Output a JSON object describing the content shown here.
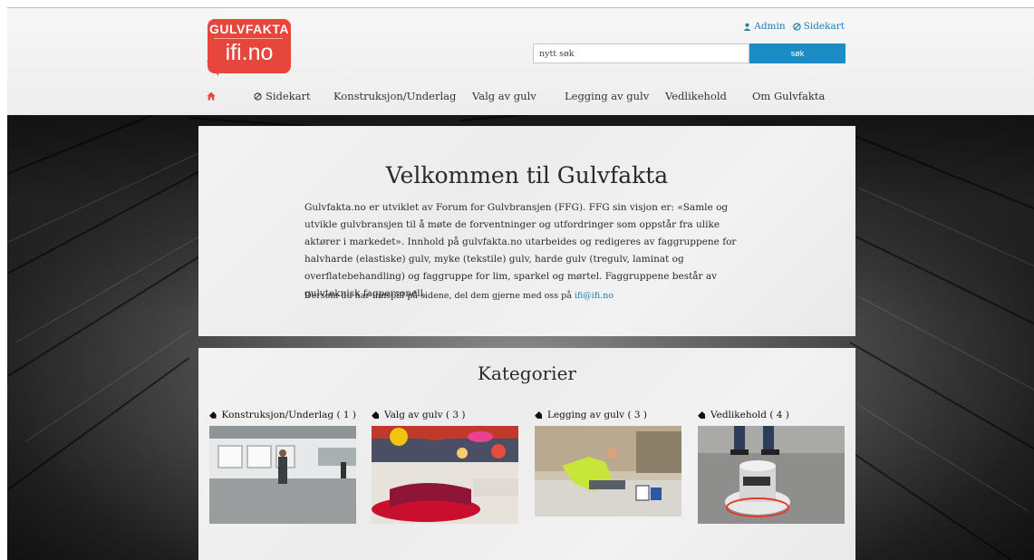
{
  "logo": {
    "line1": "GULVFAKTA",
    "line2": "ifi.no"
  },
  "toplinks": [
    {
      "icon": "user-icon",
      "label": "Admin"
    },
    {
      "icon": "sitemap-icon",
      "label": "Sidekart"
    }
  ],
  "search": {
    "value": "nytt søk",
    "button": "søk"
  },
  "nav": {
    "home_icon": "home-icon",
    "items": [
      {
        "label": "Sidekart",
        "icon": "sitemap-icon"
      },
      {
        "label": "Konstruksjon/Underlag"
      },
      {
        "label": "Valg av gulv"
      },
      {
        "label": "Legging av gulv"
      },
      {
        "label": "Vedlikehold"
      },
      {
        "label": "Om Gulvfakta"
      }
    ]
  },
  "welcome": {
    "title": "Velkommen til Gulvfakta",
    "body": "Gulvfakta.no er utviklet av Forum for Gulvbransjen (FFG). FFG sin visjon er: «Samle og utvikle gulvbransjen til å møte de forventninger og utfordringer som oppstår fra ulike aktører i markedet». Innhold på gulvfakta.no utarbeides og redigeres av faggruppene for halvharde (elastiske) gulv, myke (tekstile) gulv, harde gulv (tregulv, laminat og overflatebehandling) og faggruppe for lim, sparkel og mørtel. Faggruppene består av gulvteknisk fagpersonell.",
    "contact_text": "Dersom du har innspill på sidene, del dem gjerne med oss på ",
    "contact_link": "ifi@ifi.no"
  },
  "categories": {
    "title": "Kategorier",
    "items": [
      {
        "label": "Konstruksjon/Underlag ( 1 )",
        "icon": "tag-icon"
      },
      {
        "label": "Valg av gulv ( 3 )",
        "icon": "tag-icon"
      },
      {
        "label": "Legging av gulv ( 3 )",
        "icon": "tag-icon"
      },
      {
        "label": "Vedlikehold ( 4 )",
        "icon": "tag-icon"
      }
    ]
  },
  "colors": {
    "accent": "#1b8dc4",
    "brand": "#e6463c",
    "link": "#1a7fb3"
  }
}
